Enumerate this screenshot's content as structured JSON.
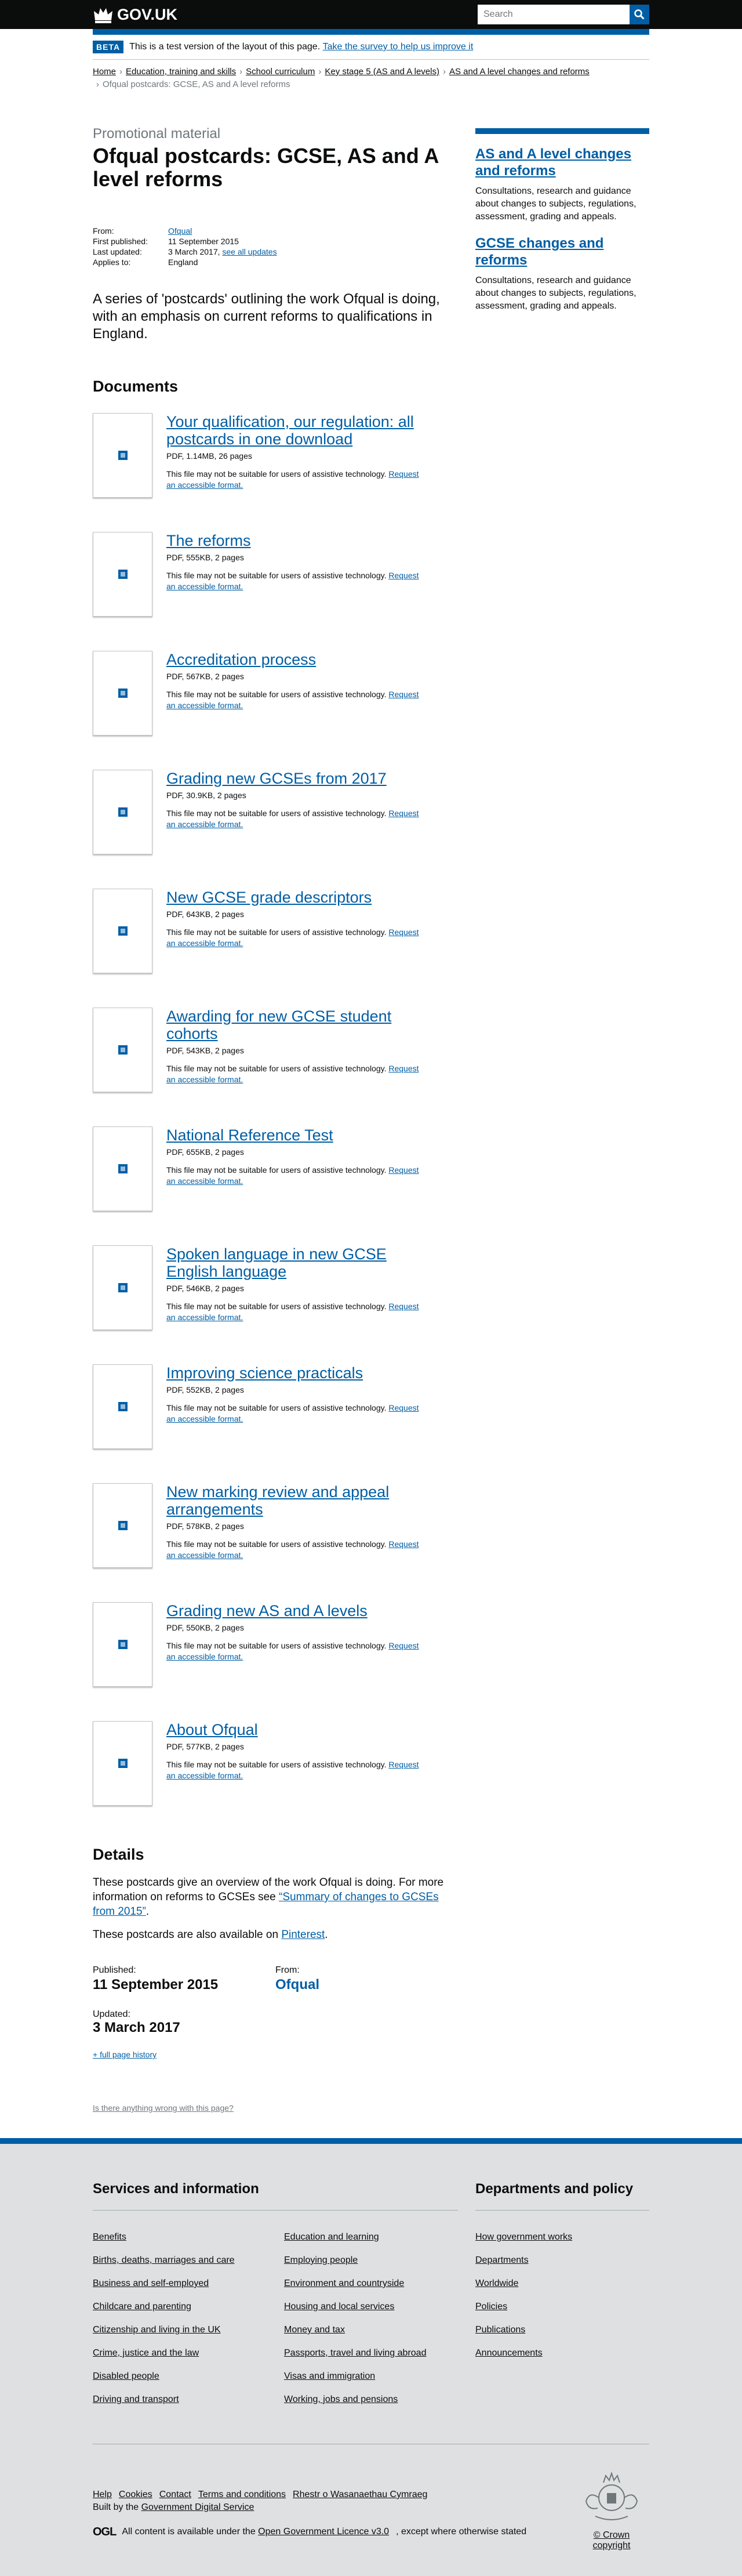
{
  "header": {
    "logo_text": "GOV.UK",
    "search_placeholder": "Search",
    "search_icon": "magnifier-icon"
  },
  "phase": {
    "tag": "BETA",
    "text": "This is a test version of the layout of this page.",
    "link": "Take the survey to help us improve it"
  },
  "breadcrumbs": [
    "Home",
    "Education, training and skills",
    "School curriculum",
    "Key stage 5 (AS and A levels)",
    "AS and A level changes and reforms"
  ],
  "breadcrumb_current": "Ofqual postcards: GCSE, AS and A level reforms",
  "page": {
    "kicker": "Promotional material",
    "title": "Ofqual postcards: GCSE, AS and A level reforms",
    "meta": {
      "from_label": "From:",
      "from_value": "Ofqual",
      "first_label": "First published:",
      "first_value": "11 September 2015",
      "updated_label": "Last updated:",
      "updated_value": "3 March 2017,",
      "updated_link": "see all updates",
      "applies_label": "Applies to:",
      "applies_value": "England"
    },
    "description": "A series of 'postcards' outlining the work Ofqual is doing, with an emphasis on current reforms to qualifications in England."
  },
  "sidebar": [
    {
      "title": "AS and A level changes and reforms",
      "desc": "Consultations, research and guidance about changes to subjects, regulations, assessment, grading and appeals."
    },
    {
      "title": "GCSE changes and reforms",
      "desc": "Consultations, research and guidance about changes to subjects, regulations, assessment, grading and appeals."
    }
  ],
  "documents_heading": "Documents",
  "warning_text": "This file may not be suitable for users of assistive technology.",
  "warning_link": "Request an accessible format.",
  "documents": [
    {
      "title": "Your qualification, our regulation: all postcards in one download",
      "meta": "PDF, 1.14MB, 26 pages"
    },
    {
      "title": "The reforms",
      "meta": "PDF, 555KB, 2 pages"
    },
    {
      "title": "Accreditation process",
      "meta": "PDF, 567KB, 2 pages"
    },
    {
      "title": "Grading new GCSEs from 2017",
      "meta": "PDF, 30.9KB, 2 pages"
    },
    {
      "title": "New GCSE grade descriptors",
      "meta": "PDF, 643KB, 2 pages"
    },
    {
      "title": "Awarding for new GCSE student cohorts",
      "meta": "PDF, 543KB, 2 pages"
    },
    {
      "title": "National Reference Test",
      "meta": "PDF, 655KB, 2 pages"
    },
    {
      "title": "Spoken language in new GCSE English language",
      "meta": "PDF, 546KB, 2 pages"
    },
    {
      "title": "Improving science practicals",
      "meta": "PDF, 552KB, 2 pages"
    },
    {
      "title": "New marking review and appeal arrangements",
      "meta": "PDF, 578KB, 2 pages"
    },
    {
      "title": "Grading new AS and A levels",
      "meta": "PDF, 550KB, 2 pages"
    },
    {
      "title": "About Ofqual",
      "meta": "PDF, 577KB, 2 pages"
    }
  ],
  "details": {
    "heading": "Details",
    "para1_text": "These postcards give an overview of the work Ofqual is doing. For more information on reforms to GCSEs see",
    "para1_link": "“Summary of changes to GCSEs from 2015”",
    "para1_end": ".",
    "para2_text": "These postcards are also available on",
    "para2_link": "Pinterest",
    "para2_end": "."
  },
  "publication": {
    "published_label": "Published:",
    "published_value": "11 September 2015",
    "from_label": "From:",
    "from_value": "Ofqual",
    "updated_label": "Updated:",
    "updated_value": "3 March 2017",
    "history_link": "+ full page history",
    "wrong_link": "Is there anything wrong with this page?"
  },
  "footer": {
    "services_heading": "Services and information",
    "services_col1": [
      "Benefits",
      "Births, deaths, marriages and care",
      "Business and self-employed",
      "Childcare and parenting",
      "Citizenship and living in the UK",
      "Crime, justice and the law",
      "Disabled people",
      "Driving and transport"
    ],
    "services_col2": [
      "Education and learning",
      "Employing people",
      "Environment and countryside",
      "Housing and local services",
      "Money and tax",
      "Passports, travel and living abroad",
      "Visas and immigration",
      "Working, jobs and pensions"
    ],
    "dept_heading": "Departments and policy",
    "dept_links": [
      "How government works",
      "Departments",
      "Worldwide",
      "Policies",
      "Publications",
      "Announcements"
    ],
    "meta_links": [
      "Help",
      "Cookies",
      "Contact",
      "Terms and conditions",
      "Rhestr o Wasanaethau Cymraeg"
    ],
    "built_by": "Built by the",
    "built_by_link": "Government Digital Service",
    "ogl_logo": "OGL",
    "licence_pre": "All content is available under the",
    "licence_link": "Open Government Licence v3.0",
    "licence_post": ", except where otherwise stated",
    "copyright": "© Crown copyright"
  }
}
